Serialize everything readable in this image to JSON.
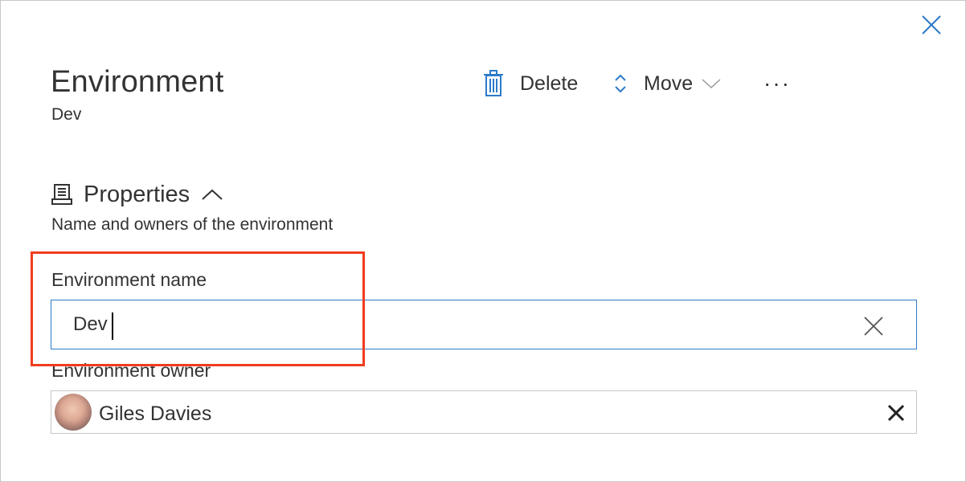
{
  "panel": {
    "title": "Environment",
    "subtitle": "Dev"
  },
  "toolbar": {
    "delete_label": "Delete",
    "move_label": "Move",
    "more_label": "···"
  },
  "properties": {
    "heading": "Properties",
    "description": "Name and owners of the environment"
  },
  "fields": {
    "name_label": "Environment name",
    "name_value": "Dev",
    "owner_label": "Environment owner",
    "owner_name": "Giles Davies"
  },
  "colors": {
    "accent": "#2c7ac9",
    "highlight": "#f03c1e",
    "text": "#333333"
  },
  "icons": {
    "close": "close-icon",
    "delete": "trash-icon",
    "move": "updown-chevron-icon",
    "move_dropdown": "chevron-down-icon",
    "more": "ellipsis-icon",
    "properties": "properties-icon",
    "collapse": "chevron-up-icon",
    "clear": "clear-icon",
    "remove_owner": "remove-icon"
  }
}
